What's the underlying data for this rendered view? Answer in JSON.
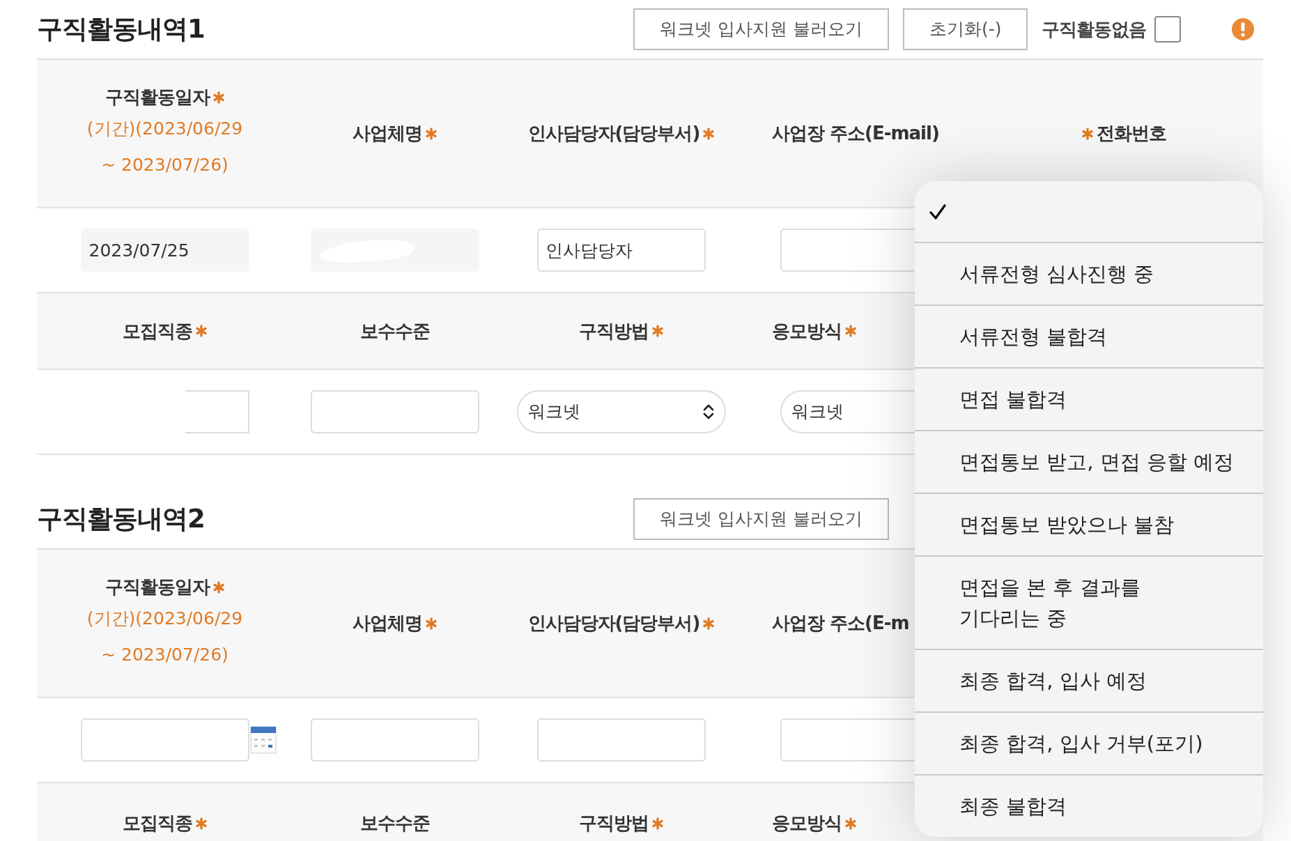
{
  "sections": [
    {
      "title": "구직활동내역1",
      "buttons": [
        "워크넷 입사지원 불러오기",
        "초기화(-)"
      ],
      "no_activity": {
        "label": "구직활동없음",
        "checked": false
      },
      "alert": true,
      "header_rows": [
        [
          {
            "label": "구직활동일자",
            "required": true,
            "star_before": false,
            "period": "(기간)(2023/06/29 ~ 2023/07/26)"
          },
          {
            "label": "사업체명",
            "required": true,
            "star_before": false
          },
          {
            "label": "인사담당자(담당부서)",
            "required": true,
            "star_before": false
          },
          {
            "label": "사업장 주소(E-mail)",
            "required": false
          },
          {
            "label": "전화번호",
            "required": true,
            "star_before": true
          }
        ],
        [
          {
            "label": "모집직종",
            "required": true
          },
          {
            "label": "보수수준",
            "required": false
          },
          {
            "label": "구직방법",
            "required": true
          },
          {
            "label": "응모방식",
            "required": true
          }
        ]
      ],
      "input_rows": [
        [
          {
            "kind": "readonly",
            "value": "2023/07/25"
          },
          {
            "kind": "readonly",
            "redacted": true
          },
          {
            "kind": "text",
            "value": "인사담당자"
          },
          {
            "kind": "text"
          }
        ],
        [
          {
            "kind": "text",
            "redacted": true
          },
          {
            "kind": "text"
          },
          {
            "kind": "select",
            "value": "워크넷",
            "chevron": true
          },
          {
            "kind": "select",
            "value": "워크넷",
            "chevron": false
          }
        ]
      ]
    },
    {
      "title": "구직활동내역2",
      "buttons": [
        "워크넷 입사지원 불러오기"
      ],
      "alert": false,
      "header_rows": [
        [
          {
            "label": "구직활동일자",
            "required": true,
            "star_before": false,
            "period": "(기간)(2023/06/29 ~ 2023/07/26)"
          },
          {
            "label": "사업체명",
            "required": true,
            "star_before": false
          },
          {
            "label": "인사담당자(담당부서)",
            "required": true,
            "star_before": false
          },
          {
            "label": "사업장 주소(E-m",
            "required": false
          }
        ],
        [
          {
            "label": "모집직종",
            "required": true
          },
          {
            "label": "보수수준",
            "required": false
          },
          {
            "label": "구직방법",
            "required": true
          },
          {
            "label": "응모방식",
            "required": true
          }
        ]
      ],
      "input_rows": [
        [
          {
            "kind": "date"
          },
          {
            "kind": "text"
          },
          {
            "kind": "text"
          },
          {
            "kind": "text"
          }
        ]
      ]
    }
  ],
  "dropdown": {
    "options": [
      {
        "selected": true
      },
      {
        "label": "서류전형 심사진행 중",
        "selected": false
      },
      {
        "label": "서류전형 불합격",
        "selected": false
      },
      {
        "label": "면접 불합격",
        "selected": false
      },
      {
        "label": "면접통보 받고, 면접 응할 예정",
        "selected": false
      },
      {
        "label": "면접통보 받았으나 불참",
        "selected": false
      },
      {
        "label": "면접을 본 후 결과를\n기다리는 중",
        "selected": false
      },
      {
        "label": "최종 합격, 입사 예정",
        "selected": false
      },
      {
        "label": "최종 합격, 입사 거부(포기)",
        "selected": false
      },
      {
        "label": "최종 불합격",
        "selected": false
      }
    ]
  }
}
